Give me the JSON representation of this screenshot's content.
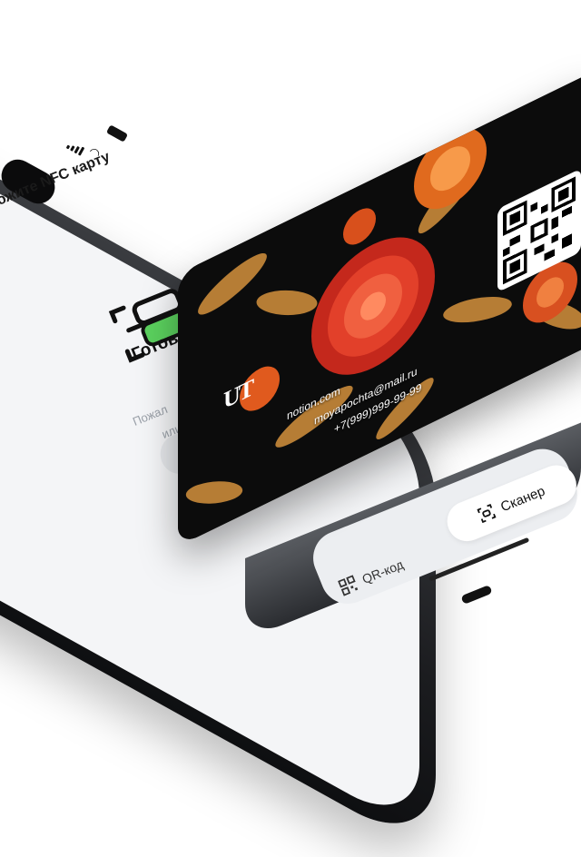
{
  "screen": {
    "title": "ожите NFC карту",
    "ready_text": "Готовы сканировать",
    "hint_line1": "Пожал",
    "hint_line2": "или",
    "tabs": {
      "qr_label": "QR-код",
      "scanner_label": "Сканер",
      "selected": "Сканер"
    }
  },
  "card": {
    "logo": "UT",
    "website": "notion.com",
    "email": "moyapochta@mail.ru",
    "phone": "+7(999)999-99-99"
  },
  "colors": {
    "accent": "#5bd15e",
    "card_bg": "#0c0c0c",
    "phone_frame": "#2a2c30",
    "screen_bg": "#f4f5f7"
  },
  "icons": [
    "scan-icon",
    "qr-icon",
    "signal-icon",
    "wifi-icon",
    "battery-icon"
  ]
}
